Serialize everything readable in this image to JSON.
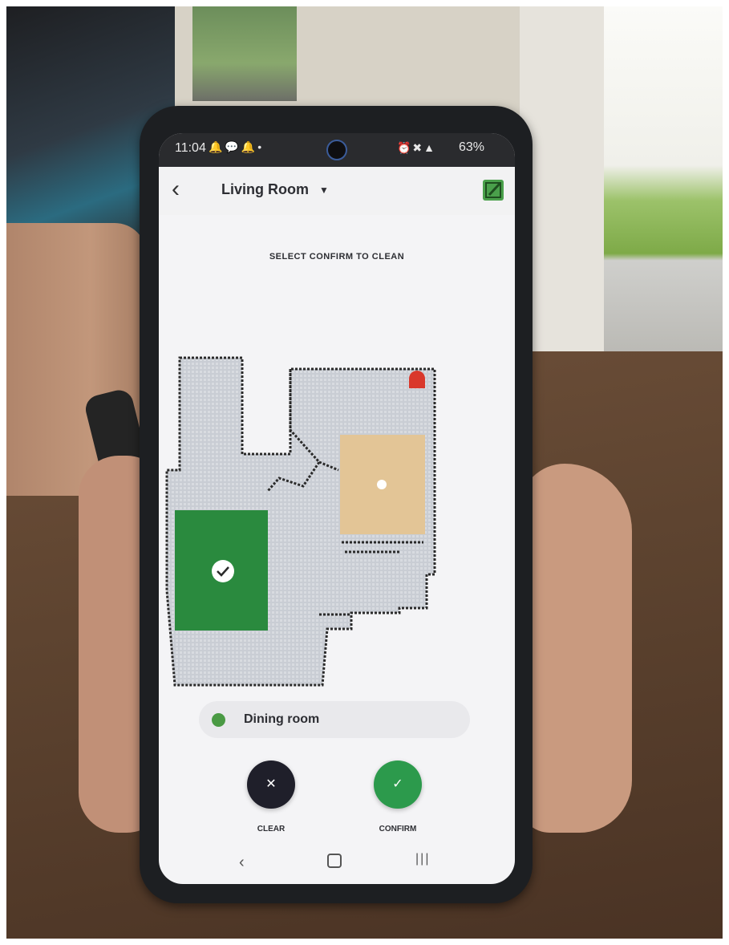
{
  "status_bar": {
    "time": "11:04",
    "battery": "63%"
  },
  "app_bar": {
    "title": "Living Room",
    "dropdown_icon": "triangle-down-icon",
    "edit_icon": "pencil-icon"
  },
  "instruction": "SELECT CONFIRM TO CLEAN",
  "selected_room": {
    "label": "Dining room",
    "color": "#4a9a44"
  },
  "actions": {
    "clear_label": "CLEAR",
    "confirm_label": "CONFIRM"
  },
  "colors": {
    "accent_green": "#2c9a4c",
    "highlight_sand": "#e3c596",
    "dock_red": "#d9382c"
  }
}
